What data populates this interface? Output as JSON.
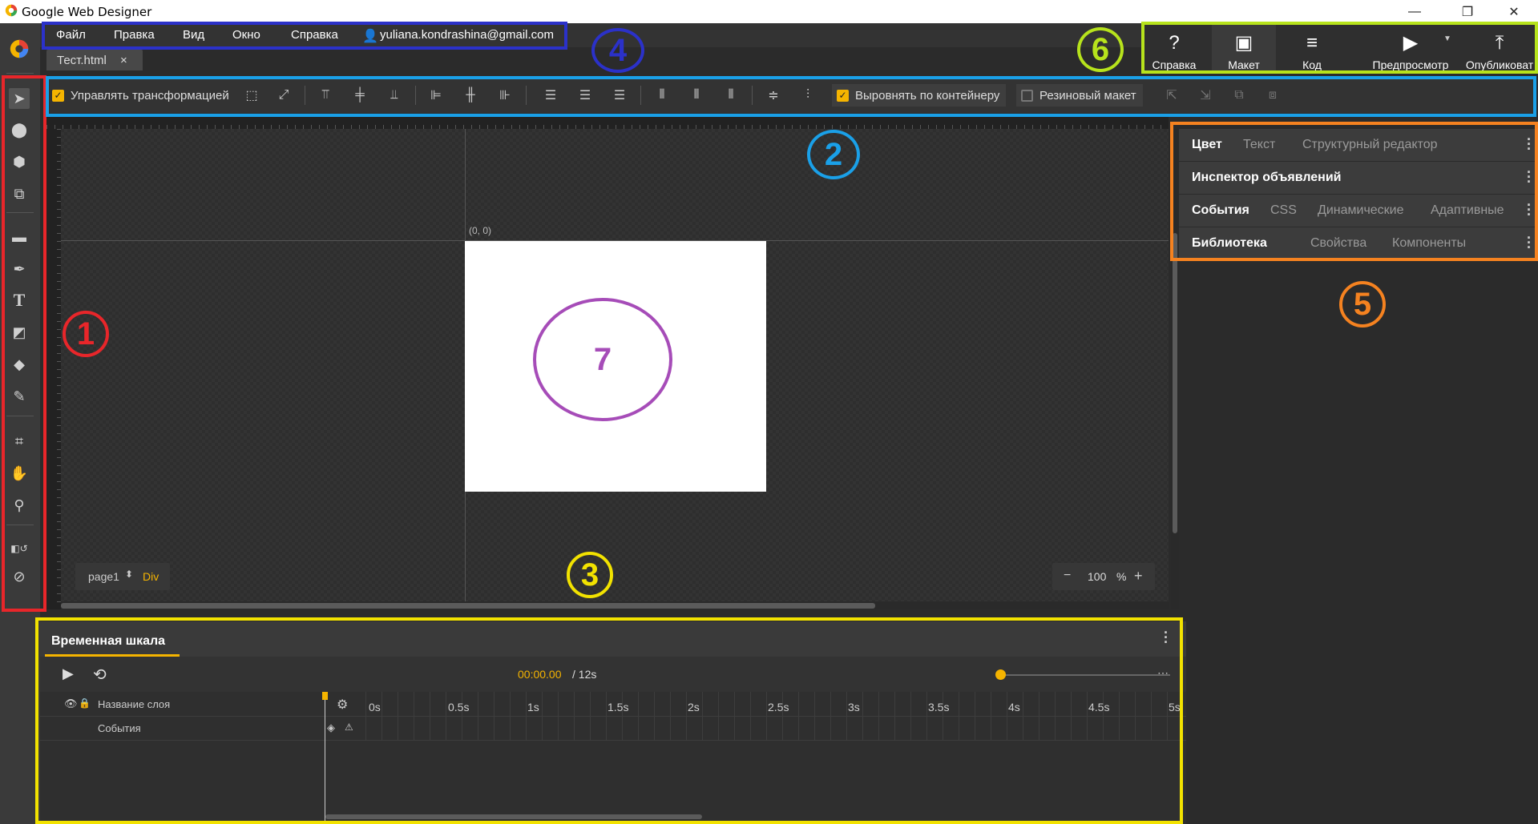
{
  "window": {
    "title": "Google Web Designer",
    "controls": [
      "—",
      "❐",
      "✕"
    ]
  },
  "menu": {
    "items": [
      "Файл",
      "Правка",
      "Вид",
      "Окно",
      "Справка"
    ],
    "user_email": "yuliana.kondrashina@gmail.com"
  },
  "file_tab": {
    "name": "Тест.html",
    "close": "×"
  },
  "actions": [
    {
      "label": "Справка",
      "icon": "help-icon",
      "glyph": "?"
    },
    {
      "label": "Макет",
      "icon": "design-icon",
      "glyph": "▣"
    },
    {
      "label": "Код",
      "icon": "code-icon",
      "glyph": "≡"
    },
    {
      "label": "Предпросмотр",
      "icon": "preview-icon",
      "glyph": "▶"
    },
    {
      "label": "Опубликоват",
      "icon": "publish-icon",
      "glyph": "⤒"
    }
  ],
  "options": {
    "transform_label": "Управлять трансформацией",
    "transform_checked": true,
    "align_container_label": "Выровнять по контейнеру",
    "align_container_checked": true,
    "fluid_label": "Резиновый макет",
    "fluid_checked": false
  },
  "canvas": {
    "origin": "(0, 0)",
    "page_name": "page1",
    "element_type": "Div",
    "zoom_minus": "−",
    "zoom_value": "100",
    "zoom_unit": "%",
    "zoom_plus": "+"
  },
  "right_panel": {
    "rows": [
      {
        "tabs": [
          "Цвет",
          "Текст",
          "Структурный редактор"
        ],
        "active": 0
      },
      {
        "tabs": [
          "Инспектор объявлений"
        ],
        "active": 0
      },
      {
        "tabs": [
          "События",
          "CSS",
          "Динамические",
          "Адаптивные"
        ],
        "active": 0
      },
      {
        "tabs": [
          "Библиотека",
          "Свойства",
          "Компоненты"
        ],
        "active": 0
      }
    ]
  },
  "timeline": {
    "title": "Временная шкала",
    "current_time": "00:00.00",
    "total_time": "/ 12s",
    "layer_header": "Название слоя",
    "events_row": "События",
    "ticks": [
      "0s",
      "0.5s",
      "1s",
      "1.5s",
      "2s",
      "2.5s",
      "3s",
      "3.5s",
      "4s",
      "4.5s",
      "5s"
    ]
  },
  "annotations": {
    "labels": [
      "1",
      "2",
      "3",
      "4",
      "5",
      "6",
      "7"
    ],
    "colors": {
      "1": "#e8262a",
      "2": "#1aa0e8",
      "3": "#f2e200",
      "4": "#2b31c9",
      "5": "#f58220",
      "6": "#b7e31c",
      "7": "#a64cb8"
    }
  }
}
